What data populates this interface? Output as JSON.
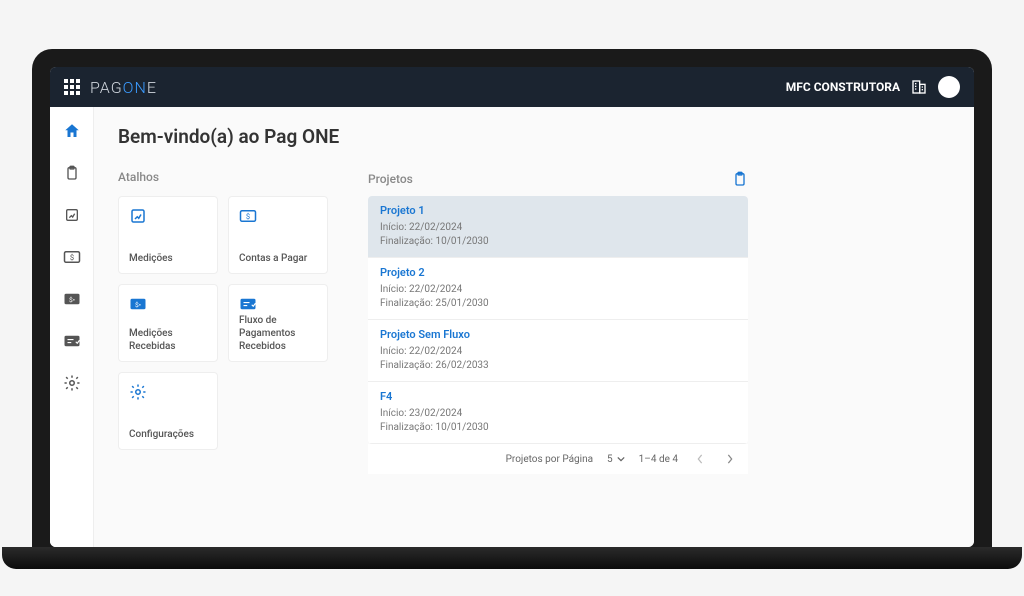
{
  "header": {
    "brand_pag": "PAG",
    "brand_one": "ON",
    "brand_e": "E",
    "company": "MFC CONSTRUTORA"
  },
  "page": {
    "title": "Bem-vindo(a) ao Pag ONE"
  },
  "sections": {
    "shortcuts_title": "Atalhos",
    "projects_title": "Projetos"
  },
  "shortcuts": [
    {
      "label": "Medições"
    },
    {
      "label": "Contas a Pagar"
    },
    {
      "label": "Medições Recebidas"
    },
    {
      "label": "Fluxo de Pagamentos Recebidos"
    },
    {
      "label": "Configurações"
    }
  ],
  "projects": [
    {
      "title": "Projeto 1",
      "start_label": "Início:",
      "start": "22/02/2024",
      "end_label": "Finalização:",
      "end": "10/01/2030",
      "selected": true
    },
    {
      "title": "Projeto 2",
      "start_label": "Início:",
      "start": "22/02/2024",
      "end_label": "Finalização:",
      "end": "25/01/2030",
      "selected": false
    },
    {
      "title": "Projeto Sem Fluxo",
      "start_label": "Início:",
      "start": "22/02/2024",
      "end_label": "Finalização:",
      "end": "26/02/2033",
      "selected": false
    },
    {
      "title": "F4",
      "start_label": "Início:",
      "start": "23/02/2024",
      "end_label": "Finalização:",
      "end": "10/01/2030",
      "selected": false
    }
  ],
  "pagination": {
    "per_page_label": "Projetos por Página",
    "per_page_value": "5",
    "range": "1–4 de 4"
  }
}
